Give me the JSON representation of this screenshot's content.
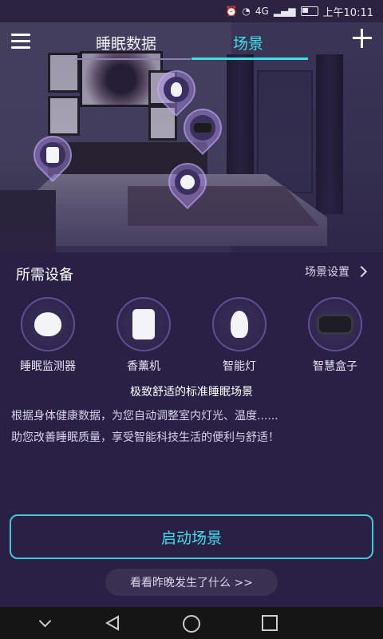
{
  "status_bar": {
    "network": "4G",
    "time_label": "上午10:11"
  },
  "header": {
    "tabs": [
      {
        "label": "睡眠数据",
        "active": false
      },
      {
        "label": "场景",
        "active": true
      }
    ]
  },
  "devices_section": {
    "title": "所需设备",
    "settings_link": "场景设置",
    "items": [
      {
        "label": "睡眠监测器",
        "icon": "sleep-monitor-icon"
      },
      {
        "label": "香薰机",
        "icon": "aroma-diffuser-icon"
      },
      {
        "label": "智能灯",
        "icon": "smart-bulb-icon"
      },
      {
        "label": "智慧盒子",
        "icon": "smart-box-icon"
      }
    ]
  },
  "scene": {
    "tagline": "极致舒适的标准睡眠场景",
    "description_line1": "根据身体健康数据，为您自动调整室内灯光、温度......",
    "description_line2": "助您改善睡眠质量，享受智能科技生活的便利与舒适！"
  },
  "actions": {
    "start_label": "启动场景",
    "last_night_label": "看看昨晚发生了什么 >>"
  },
  "colors": {
    "accent": "#3fe0e6",
    "background": "#2a2046",
    "circle_border": "#5f4f92"
  }
}
